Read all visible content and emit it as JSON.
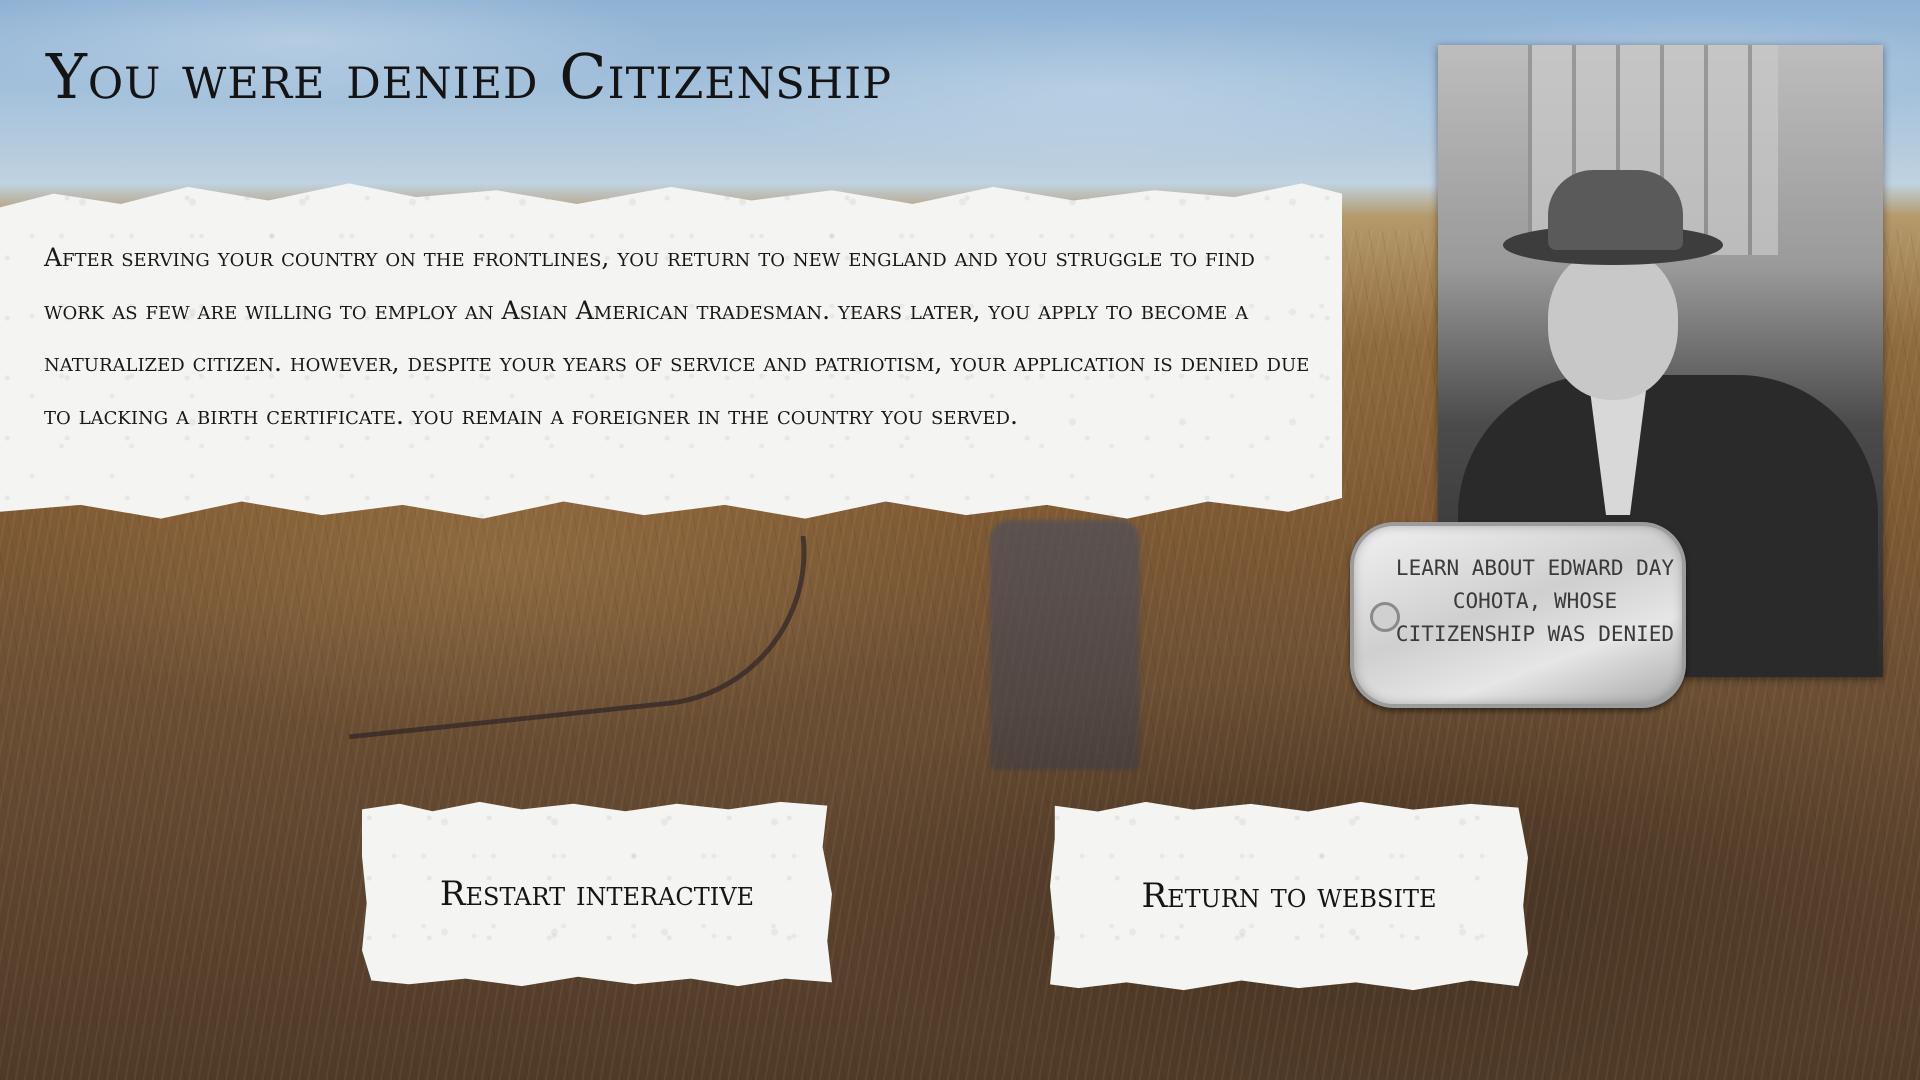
{
  "page": {
    "title": "You were denied Citizenship"
  },
  "story": {
    "text": "After serving your country on the frontlines, you return to new england and you struggle to find work as few are willing to employ an Asian American tradesman. years later, you apply to become a naturalized citizen. however, despite your years of service and patriotism, your application is denied due to lacking a birth certificate. you remain a foreigner in the country you served."
  },
  "learn_more": {
    "label": "LEARN ABOUT EDWARD DAY COHOTA, WHOSE CITIZENSHIP WAS DENIED"
  },
  "actions": {
    "restart_label": "Restart interactive",
    "return_label": "Return to website"
  },
  "colors": {
    "sky": "#8fb2d4",
    "field": "#7e5a34",
    "paper": "#f4f4f2",
    "text": "#141414",
    "dog_tag": "#cfcfcf"
  }
}
